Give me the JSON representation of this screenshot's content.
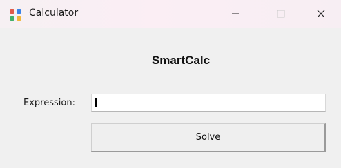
{
  "window": {
    "title": "Calculator",
    "icon": "calculator-app-icon",
    "controls": [
      "minimize-icon",
      "maximize-icon",
      "close-icon"
    ]
  },
  "main": {
    "heading": "SmartCalc",
    "expression_label": "Expression:",
    "expression_value": "",
    "solve_label": "Solve"
  },
  "colors": {
    "icon_red": "#e05a4a",
    "icon_blue": "#3a82e6",
    "icon_green": "#43b06a",
    "icon_yellow": "#f1b63a",
    "window_bg": "#f0f0f0"
  }
}
